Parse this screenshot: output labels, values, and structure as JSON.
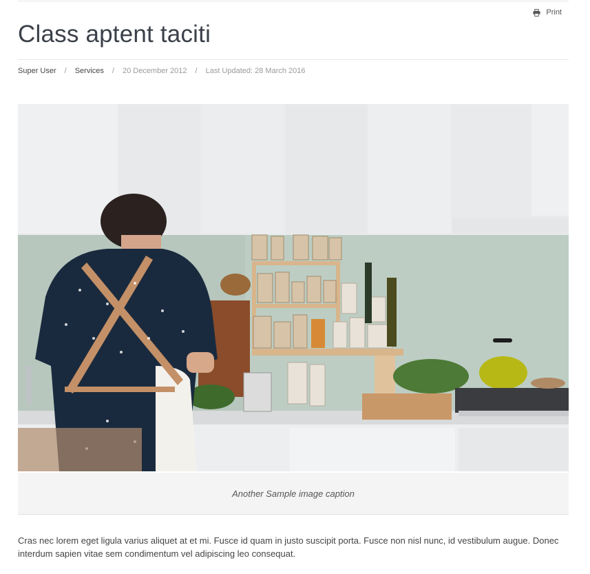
{
  "article": {
    "print_label": "Print",
    "title": "Class aptent taciti",
    "meta": {
      "author": "Super User",
      "category": "Services",
      "published": "20 December 2012",
      "updated": "Last Updated: 28 March 2016",
      "separator": "/"
    },
    "image_caption": "Another Sample image caption",
    "paragraph_1": "Cras nec lorem eget ligula varius aliquet at et mi. Fusce id quam in justo suscipit porta. Fusce non nisl nunc, id vestibulum augue. Donec interdum sapien vitae sem condimentum vel adipiscing leo consequat."
  },
  "icons": {
    "print": "printer-icon"
  }
}
